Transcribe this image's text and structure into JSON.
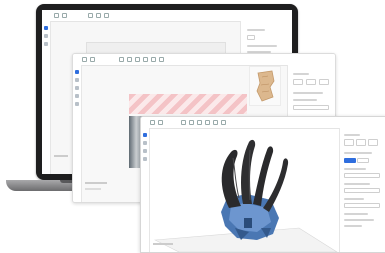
{
  "colors": {
    "accent": "#2f6ede",
    "laptop_frame": "#1e1e1f",
    "part_blue": "#4a77b3",
    "part_dark": "#2a2a2c",
    "support_pink": "#f4c3c6",
    "support_bg": "#fbe9ea"
  },
  "icons": {
    "toolbar": [
      "open-file-icon",
      "save-icon",
      "undo-icon",
      "redo-icon",
      "move-icon",
      "rotate-icon",
      "scale-icon",
      "cut-icon",
      "support-icon",
      "slice-icon"
    ],
    "sidebar": [
      "select-icon",
      "pan-icon",
      "measure-icon",
      "view-icon",
      "layers-icon",
      "settings-icon"
    ]
  },
  "laptop": {
    "description_label": ""
  },
  "windows": {
    "front": {
      "action_button": ""
    }
  }
}
